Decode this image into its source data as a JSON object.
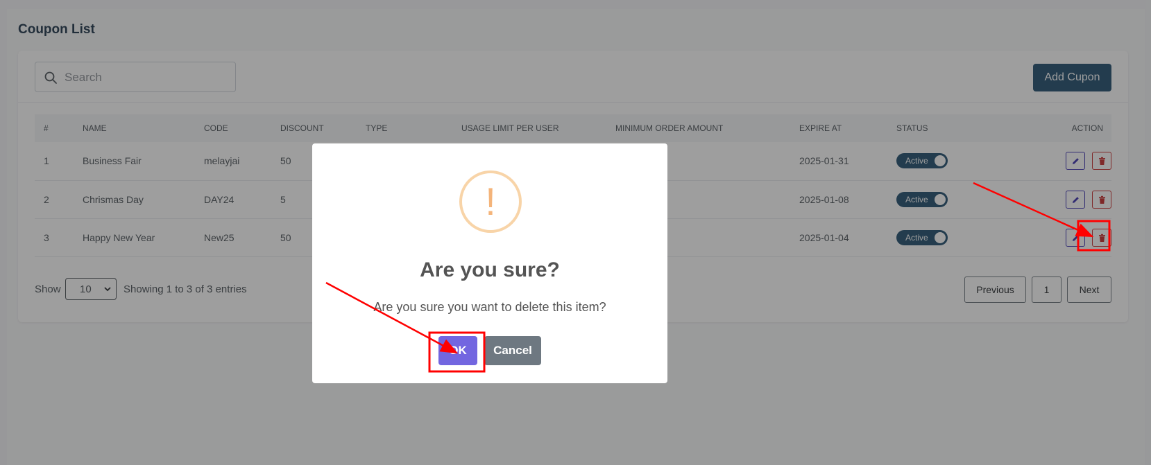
{
  "page": {
    "title": "Coupon List"
  },
  "toolbar": {
    "search_placeholder": "Search",
    "add_button": "Add Cupon"
  },
  "table": {
    "headers": [
      "#",
      "NAME",
      "CODE",
      "DISCOUNT",
      "TYPE",
      "USAGE LIMIT PER USER",
      "MINIMUM ORDER AMOUNT",
      "EXPIRE AT",
      "STATUS",
      "ACTION"
    ],
    "rows": [
      {
        "num": "1",
        "name": "Business Fair",
        "code": "melayjai",
        "discount": "50",
        "type": "",
        "usage_limit": "",
        "min_order": "",
        "expire_at": "2025-01-31",
        "status": "Active"
      },
      {
        "num": "2",
        "name": "Chrismas Day",
        "code": "DAY24",
        "discount": "5",
        "type": "",
        "usage_limit": "",
        "min_order": "",
        "expire_at": "2025-01-08",
        "status": "Active"
      },
      {
        "num": "3",
        "name": "Happy New Year",
        "code": "New25",
        "discount": "50",
        "type": "",
        "usage_limit": "",
        "min_order": "",
        "expire_at": "2025-01-04",
        "status": "Active"
      }
    ]
  },
  "footer": {
    "show_label": "Show",
    "page_size": "10",
    "entries_text": "Showing 1 to 3 of 3 entries",
    "prev_label": "Previous",
    "current_page": "1",
    "next_label": "Next"
  },
  "dialog": {
    "icon_glyph": "!",
    "title": "Are you sure?",
    "message": "Are you sure you want to delete this item?",
    "ok_label": "OK",
    "cancel_label": "Cancel"
  },
  "colors": {
    "primary": "#1f4e6e",
    "ok": "#7266e0",
    "cancel": "#6e7881",
    "warning": "#f8bb86",
    "annotation": "#ff0000"
  }
}
